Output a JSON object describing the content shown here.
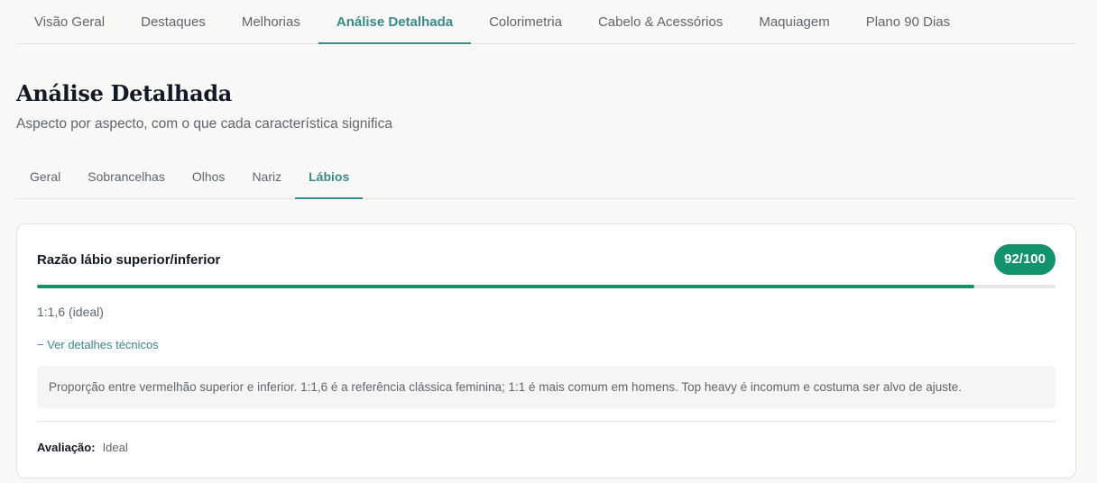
{
  "top_tabs": [
    {
      "label": "Visão Geral",
      "active": false
    },
    {
      "label": "Destaques",
      "active": false
    },
    {
      "label": "Melhorias",
      "active": false
    },
    {
      "label": "Análise Detalhada",
      "active": true
    },
    {
      "label": "Colorimetria",
      "active": false
    },
    {
      "label": "Cabelo & Acessórios",
      "active": false
    },
    {
      "label": "Maquiagem",
      "active": false
    },
    {
      "label": "Plano 90 Dias",
      "active": false
    }
  ],
  "header": {
    "title": "Análise Detalhada",
    "subtitle": "Aspecto por aspecto, com o que cada característica significa"
  },
  "sub_tabs": [
    {
      "label": "Geral",
      "active": false
    },
    {
      "label": "Sobrancelhas",
      "active": false
    },
    {
      "label": "Olhos",
      "active": false
    },
    {
      "label": "Nariz",
      "active": false
    },
    {
      "label": "Lábios",
      "active": true
    }
  ],
  "metric": {
    "title": "Razão lábio superior/inferior",
    "score_label": "92/100",
    "score_percent": 92,
    "value": "1:1,6 (ideal)",
    "details_toggle": "− Ver detalhes técnicos",
    "details_text": "Proporção entre vermelhão superior e inferior. 1:1,6 é a referência clássica feminina; 1:1 é mais comum em homens. Top heavy é incomum e costuma ser alvo de ajuste.",
    "assessment_label": "Avaliação:",
    "assessment_value": "Ideal"
  },
  "colors": {
    "accent": "#3a8a8c",
    "score": "#12936b",
    "background": "#f8f8f6"
  }
}
